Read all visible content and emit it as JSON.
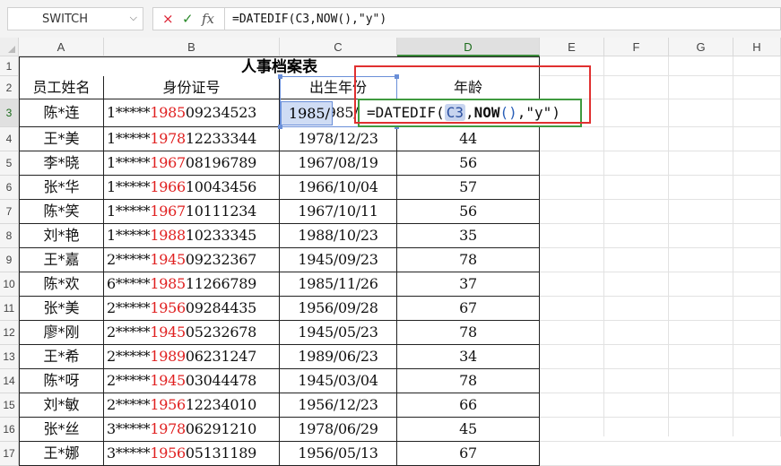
{
  "namebox": {
    "value": "SWITCH"
  },
  "formula_bar": {
    "cancel_icon": "×",
    "enter_icon": "✓",
    "fx_label": "fx",
    "formula": "=DATEDIF(C3,NOW(),\"y\")"
  },
  "columns": [
    "A",
    "B",
    "C",
    "D",
    "E",
    "F",
    "G",
    "H"
  ],
  "active_column": "D",
  "rows": [
    "1",
    "2",
    "3",
    "4",
    "5",
    "6",
    "7",
    "8",
    "9",
    "10",
    "11",
    "12",
    "13",
    "14",
    "15",
    "16",
    "17"
  ],
  "active_row": "3",
  "sheet": {
    "title": "人事档案表",
    "headers": {
      "name": "员工姓名",
      "id": "身份证号",
      "birth": "出生年份",
      "age": "年龄"
    },
    "records": [
      {
        "name": "陈*连",
        "id_pre": "1*****",
        "id_year": "1985",
        "id_post": "09234523",
        "birth": "1985/",
        "age": ""
      },
      {
        "name": "王*美",
        "id_pre": "1*****",
        "id_year": "1978",
        "id_post": "12233344",
        "birth": "1978/12/23",
        "age": "44"
      },
      {
        "name": "李*晓",
        "id_pre": "1*****",
        "id_year": "1967",
        "id_post": "08196789",
        "birth": "1967/08/19",
        "age": "56"
      },
      {
        "name": "张*华",
        "id_pre": "1*****",
        "id_year": "1966",
        "id_post": "10043456",
        "birth": "1966/10/04",
        "age": "57"
      },
      {
        "name": "陈*笑",
        "id_pre": "1*****",
        "id_year": "1967",
        "id_post": "10111234",
        "birth": "1967/10/11",
        "age": "56"
      },
      {
        "name": "刘*艳",
        "id_pre": "1*****",
        "id_year": "1988",
        "id_post": "10233345",
        "birth": "1988/10/23",
        "age": "35"
      },
      {
        "name": "王*嘉",
        "id_pre": "2*****",
        "id_year": "1945",
        "id_post": "09232367",
        "birth": "1945/09/23",
        "age": "78"
      },
      {
        "name": "陈*欢",
        "id_pre": "6*****",
        "id_year": "1985",
        "id_post": "11266789",
        "birth": "1985/11/26",
        "age": "37"
      },
      {
        "name": "张*美",
        "id_pre": "2*****",
        "id_year": "1956",
        "id_post": "09284435",
        "birth": "1956/09/28",
        "age": "67"
      },
      {
        "name": "廖*刚",
        "id_pre": "2*****",
        "id_year": "1945",
        "id_post": "05232678",
        "birth": "1945/05/23",
        "age": "78"
      },
      {
        "name": "王*希",
        "id_pre": "2*****",
        "id_year": "1989",
        "id_post": "06231247",
        "birth": "1989/06/23",
        "age": "34"
      },
      {
        "name": "陈*呀",
        "id_pre": "2*****",
        "id_year": "1945",
        "id_post": "03044478",
        "birth": "1945/03/04",
        "age": "78"
      },
      {
        "name": "刘*敏",
        "id_pre": "2*****",
        "id_year": "1956",
        "id_post": "12234010",
        "birth": "1956/12/23",
        "age": "66"
      },
      {
        "name": "张*丝",
        "id_pre": "3*****",
        "id_year": "1978",
        "id_post": "06291210",
        "birth": "1978/06/29",
        "age": "45"
      },
      {
        "name": "王*娜",
        "id_pre": "3*****",
        "id_year": "1956",
        "id_post": "05131189",
        "birth": "1956/05/13",
        "age": "67"
      }
    ]
  },
  "editing": {
    "prefix": "=DATEDIF(",
    "ref": "C3",
    "sep1": ",",
    "fn": "NOW",
    "parens": "()",
    "suffix": ",\"y\")"
  },
  "colors": {
    "highlight_red": "#e02020",
    "edit_border": "#3f9a3f",
    "annotation_box": "#e03030"
  }
}
